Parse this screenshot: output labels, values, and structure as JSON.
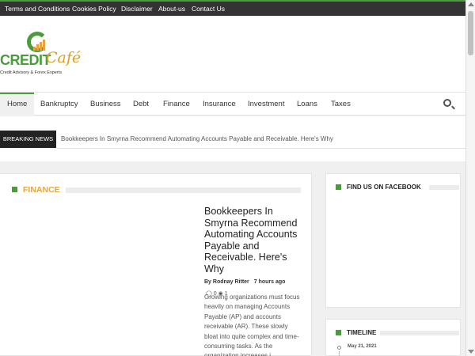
{
  "top_links": [
    "Terms and Conditions",
    "Cookies Policy",
    "Disclaimer",
    "About-us",
    "Contact Us"
  ],
  "logo": {
    "word": "CREDIT",
    "script": "Café",
    "tagline": "Credit Advisory & Forex Experts"
  },
  "nav": {
    "items": [
      "Home",
      "Bankruptcy",
      "Business",
      "Debt",
      "Finance",
      "Insurance",
      "Investment",
      "Loans",
      "Taxes"
    ],
    "active": "Home"
  },
  "breaking": {
    "label": "BREAKING NEWS",
    "text": "Bookkeepers In Smyrna Recommend Automating Accounts Payable and Receivable. Here's Why"
  },
  "section": {
    "title": "FINANCE"
  },
  "post": {
    "title": "Bookkeepers In Smyrna Recommend Automating Accounts Payable and Receivable. Here's Why",
    "author": "By Rodnay Ritter",
    "time": "7 hours ago",
    "comments": "0",
    "views": "1",
    "excerpt": "Growing organizations must focus heavily on managing Accounts Payable (AP) and accounts receivable (AR). These slowly bloat into quite complex and time-consuming tasks. As the organization increases i…"
  },
  "sidebar": {
    "facebook_title": "FIND US ON FACEBOOK",
    "timeline_title": "TIMELINE",
    "timeline_date": "May 21, 2021"
  },
  "colors": {
    "accent_green": "#4a9b3c",
    "accent_orange": "#e8a33c",
    "topbar": "#333333"
  },
  "icons": [
    "search-icon",
    "comment-icon",
    "eye-icon"
  ]
}
